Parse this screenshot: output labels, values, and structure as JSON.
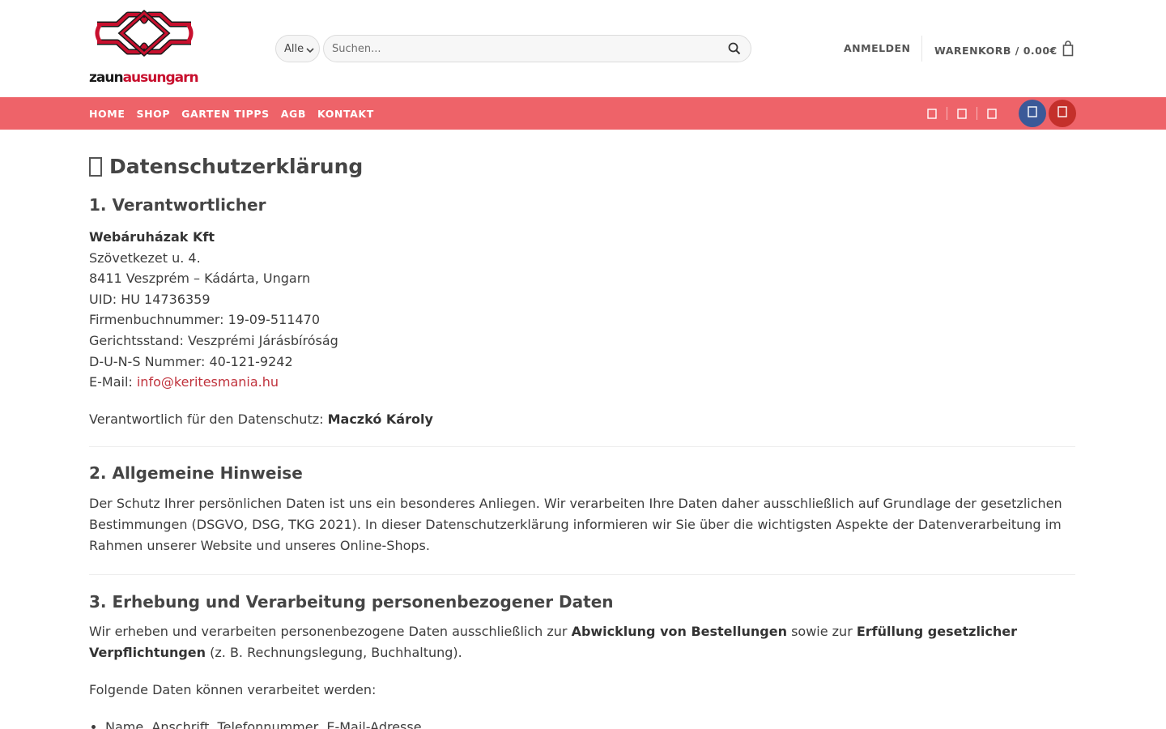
{
  "brand": {
    "logo_text_dark": "zaun",
    "logo_text_accent": "ausungarn",
    "logo_icon": "fence-logo-icon",
    "colors": {
      "accent": "#c8102e",
      "nav": "#ee6369",
      "link": "#c0333d"
    }
  },
  "search": {
    "category_value": "Alle",
    "placeholder": "Suchen...",
    "icon": "search-icon"
  },
  "header": {
    "login_label": "ANMELDEN",
    "cart_label": "WARENKORB / 0.00€",
    "cart_icon": "shopping-bag-icon"
  },
  "nav": {
    "items": [
      {
        "label": "HOME"
      },
      {
        "label": "SHOP"
      },
      {
        "label": "GARTEN TIPPS"
      },
      {
        "label": "AGB"
      },
      {
        "label": "KONTAKT"
      }
    ],
    "icons": [
      "mail-icon",
      "phone-icon",
      "whatsapp-icon"
    ],
    "social": [
      "facebook-icon",
      "youtube-icon"
    ]
  },
  "content": {
    "title": "Datenschutzerklärung",
    "s1": {
      "heading": "1. Verantwortlicher",
      "company": "Webáruházak Kft",
      "lines": [
        "Szövetkezet u. 4.",
        "8411 Veszprém – Kádárta, Ungarn",
        "UID: HU 14736359",
        "Firmenbuchnummer: 19-09-511470",
        "Gerichtsstand: Veszprémi Járásbíróság",
        "D-U-N-S Nummer: 40-121-9242"
      ],
      "email_label": "E-Mail: ",
      "email": "info@keritesmania.hu",
      "resp_label": "Verantwortlich für den Datenschutz: ",
      "resp_name": "Maczkó Károly"
    },
    "s2": {
      "heading": "2. Allgemeine Hinweise",
      "text": "Der Schutz Ihrer persönlichen Daten ist uns ein besonderes Anliegen. Wir verarbeiten Ihre Daten daher ausschließlich auf Grundlage der gesetzlichen Bestimmungen (DSGVO, DSG, TKG 2021). In dieser Datenschutzerklärung informieren wir Sie über die wichtigsten Aspekte der Datenverarbeitung im Rahmen unserer Website und unseres Online-Shops."
    },
    "s3": {
      "heading": "3. Erhebung und Verarbeitung personenbezogener Daten",
      "t1": "Wir erheben und verarbeiten personenbezogene Daten ausschließlich zur ",
      "b1": "Abwicklung von Bestellungen",
      "t2": " sowie zur ",
      "b2": "Erfüllung gesetzlicher Verpflichtungen",
      "t3": " (z. B. Rechnungslegung, Buchhaltung).",
      "intro": "Folgende Daten können verarbeitet werden:",
      "list": [
        "Name, Anschrift, Telefonnummer, E-Mail-Adresse"
      ]
    }
  }
}
